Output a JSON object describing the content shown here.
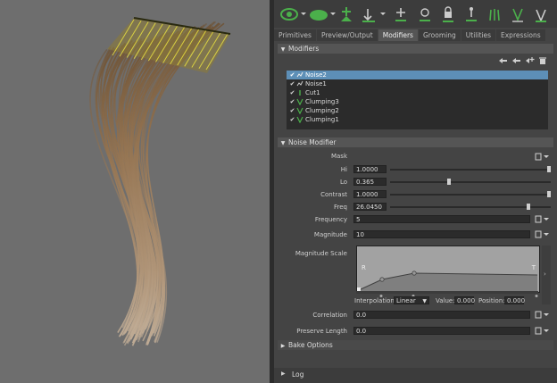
{
  "tabs": [
    {
      "label": "Primitives",
      "active": false
    },
    {
      "label": "Preview/Output",
      "active": false
    },
    {
      "label": "Modifiers",
      "active": true
    },
    {
      "label": "Grooming",
      "active": false
    },
    {
      "label": "Utilities",
      "active": false
    },
    {
      "label": "Expressions",
      "active": false
    }
  ],
  "modifiers_section": {
    "title": "Modifiers"
  },
  "modifier_list": [
    {
      "name": "Noise2",
      "selected": true
    },
    {
      "name": "Noise1",
      "selected": false
    },
    {
      "name": "Cut1",
      "selected": false
    },
    {
      "name": "Clumping3",
      "selected": false
    },
    {
      "name": "Clumping2",
      "selected": false
    },
    {
      "name": "Clumping1",
      "selected": false
    }
  ],
  "noise_section": {
    "title": "Noise Modifier",
    "mask_label": "Mask",
    "hi": {
      "label": "Hi",
      "value": "1.0000",
      "fraction": 1.0
    },
    "lo": {
      "label": "Lo",
      "value": "0.365",
      "fraction": 0.365
    },
    "contrast": {
      "label": "Contrast",
      "value": "1.0000",
      "fraction": 1.0
    },
    "freq": {
      "label": "Freq",
      "value": "26.0450",
      "fraction": 0.87
    },
    "frequency": {
      "label": "Frequency",
      "value": "5"
    },
    "magnitude": {
      "label": "Magnitude",
      "value": "10"
    },
    "magnitude_scale": {
      "label": "Magnitude Scale",
      "left_marker": "R",
      "right_marker": "T"
    },
    "interpolation": {
      "label": "Interpolation:",
      "value": "Linear"
    },
    "value_field": {
      "label": "Value:",
      "value": "0.000"
    },
    "position_field": {
      "label": "Position:",
      "value": "0.000"
    },
    "correlation": {
      "label": "Correlation",
      "value": "0.0"
    },
    "preserve_length": {
      "label": "Preserve Length",
      "value": "0.0"
    }
  },
  "bake_section": {
    "title": "Bake Options"
  },
  "log_section": {
    "title": "Log"
  },
  "colors": {
    "selection": "#5d8fb7",
    "toolbar_green": "#4bb04b",
    "hair_brown": "#8a6a45"
  }
}
